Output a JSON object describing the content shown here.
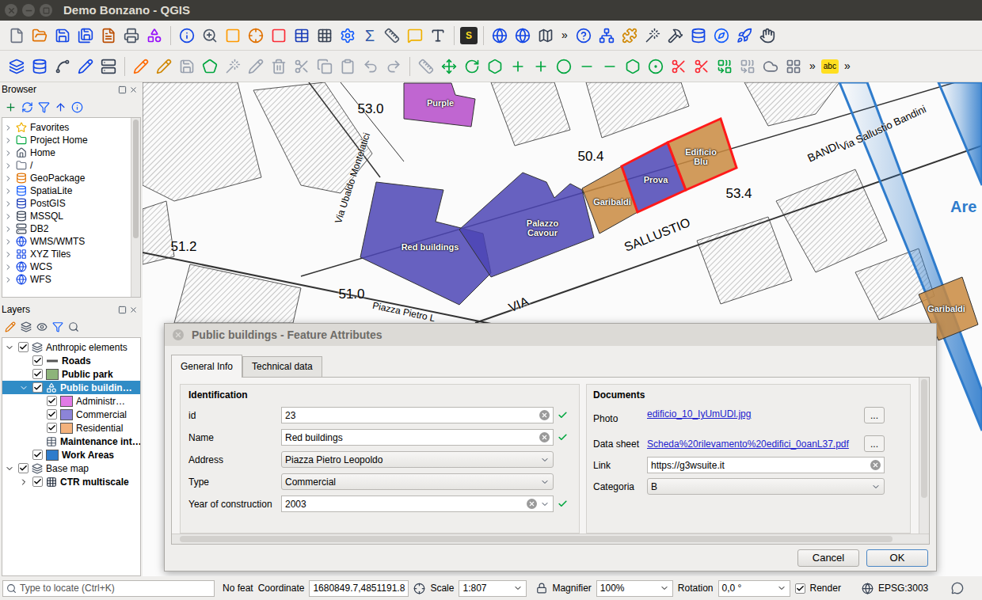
{
  "window": {
    "title": "Demo Bonzano - QGIS"
  },
  "toolbars": {
    "overflow": "»",
    "python_badge": "S",
    "label_badge": "abc",
    "sum_glyph": "Σ"
  },
  "browser": {
    "title": "Browser",
    "items": [
      {
        "label": "Favorites",
        "expanded": false
      },
      {
        "label": "Project Home",
        "expanded": false
      },
      {
        "label": "Home",
        "expanded": false
      },
      {
        "label": "/",
        "expanded": false
      },
      {
        "label": "GeoPackage",
        "expanded": false
      },
      {
        "label": "SpatiaLite",
        "expanded": false
      },
      {
        "label": "PostGIS",
        "expanded": false
      },
      {
        "label": "MSSQL",
        "expanded": false
      },
      {
        "label": "DB2",
        "expanded": false
      },
      {
        "label": "WMS/WMTS",
        "expanded": false
      },
      {
        "label": "XYZ Tiles",
        "expanded": false
      },
      {
        "label": "WCS",
        "expanded": false
      },
      {
        "label": "WFS",
        "expanded": false
      }
    ]
  },
  "layers": {
    "title": "Layers",
    "items": [
      {
        "label": "Anthropic elements",
        "kind": "group",
        "checked": true,
        "expanded": true,
        "bold": false,
        "selected": false,
        "children": [
          {
            "label": "Roads",
            "kind": "line",
            "checked": true,
            "bold": true,
            "selected": false,
            "color": "#555555"
          },
          {
            "label": "Public park",
            "kind": "polygon",
            "checked": true,
            "bold": true,
            "selected": false,
            "color": "#8db47a"
          },
          {
            "label": "Public buildin…",
            "kind": "categorized",
            "checked": true,
            "expanded": true,
            "bold": true,
            "selected": true,
            "children": [
              {
                "label": "Administr…",
                "kind": "class",
                "checked": true,
                "bold": false,
                "selected": false,
                "color": "#e27ae6"
              },
              {
                "label": "Commercial",
                "kind": "class",
                "checked": true,
                "bold": false,
                "selected": false,
                "color": "#8c84d8"
              },
              {
                "label": "Residential",
                "kind": "class",
                "checked": true,
                "bold": false,
                "selected": false,
                "color": "#f3b27c"
              }
            ]
          },
          {
            "label": "Maintenance int…",
            "kind": "table",
            "bold": true,
            "selected": false
          },
          {
            "label": "Work Areas",
            "kind": "polygon",
            "checked": true,
            "bold": true,
            "selected": false,
            "color": "#2f7ccc"
          }
        ]
      },
      {
        "label": "Base map",
        "kind": "group",
        "checked": true,
        "expanded": true,
        "bold": false,
        "selected": false,
        "children": [
          {
            "label": "CTR multiscale",
            "kind": "raster",
            "checked": true,
            "expanded": false,
            "bold": true,
            "selected": false,
            "children": []
          }
        ]
      }
    ]
  },
  "map": {
    "features": [
      {
        "label": "Purple",
        "color": "#b54bc9",
        "selected": false
      },
      {
        "label": "Red buildings",
        "color": "#4c45b5",
        "selected": false
      },
      {
        "label": "Palazzo Cavour",
        "color": "#4c45b5",
        "selected": false
      },
      {
        "label": "Garibaldi",
        "color": "#c98a3f",
        "selected": false
      },
      {
        "label": "Prova",
        "color": "#4c45b5",
        "selected": true
      },
      {
        "label": "Edificio Blu",
        "color": "#c98a3f",
        "selected": true
      },
      {
        "label": "Garibaldi",
        "color": "#c98a3f",
        "selected": false
      }
    ],
    "elevations": [
      "53.0",
      "50.4",
      "53.4",
      "51.2",
      "51.0"
    ],
    "street_labels": [
      "Via Ubaldo Montelatici",
      "VIA",
      "SALLUSTIO",
      "BANDI",
      "Via Sallustio Bandini",
      "Piazza Pietro L"
    ],
    "area_label": "Are"
  },
  "dialog": {
    "title": "Public buildings - Feature Attributes",
    "tabs": [
      {
        "label": "General Info",
        "selected": true
      },
      {
        "label": "Technical data",
        "selected": false
      }
    ],
    "identification": {
      "title": "Identification",
      "fields": [
        {
          "label": "id",
          "value": "23",
          "kind": "text",
          "valid": true
        },
        {
          "label": "Name",
          "value": "Red buildings",
          "kind": "text",
          "valid": true
        },
        {
          "label": "Address",
          "value": "Piazza Pietro Leopoldo",
          "kind": "combo",
          "valid": false
        },
        {
          "label": "Type",
          "value": "Commercial",
          "kind": "combo",
          "valid": false
        },
        {
          "label": "Year of construction",
          "value": "2003",
          "kind": "editable-combo",
          "valid": true
        }
      ]
    },
    "documents": {
      "title": "Documents",
      "fields": [
        {
          "label": "Photo",
          "value": "edificio_10_IyUmUDl.jpg",
          "kind": "file",
          "button": "..."
        },
        {
          "label": "Data sheet",
          "value": "Scheda%20rilevamento%20edifici_0oanL37.pdf",
          "kind": "file",
          "button": "..."
        },
        {
          "label": "Link",
          "value": "https://g3wsuite.it",
          "kind": "text",
          "button": ""
        },
        {
          "label": "Categoria",
          "value": "B",
          "kind": "combo",
          "button": ""
        }
      ]
    },
    "buttons": [
      {
        "label": "Cancel",
        "default": false
      },
      {
        "label": "OK",
        "default": true
      }
    ]
  },
  "status_bar": {
    "search_placeholder": "Type to locate (Ctrl+K)",
    "features": "No feat",
    "coordinate_label": "Coordinate",
    "coordinate": "1680849.7,4851191.8",
    "scale_label": "Scale",
    "scale": "1:807",
    "magnifier_label": "Magnifier",
    "magnifier": "100%",
    "rotation_label": "Rotation",
    "rotation": "0,0 °",
    "render_label": "Render",
    "render": true,
    "crs": "EPSG:3003"
  }
}
